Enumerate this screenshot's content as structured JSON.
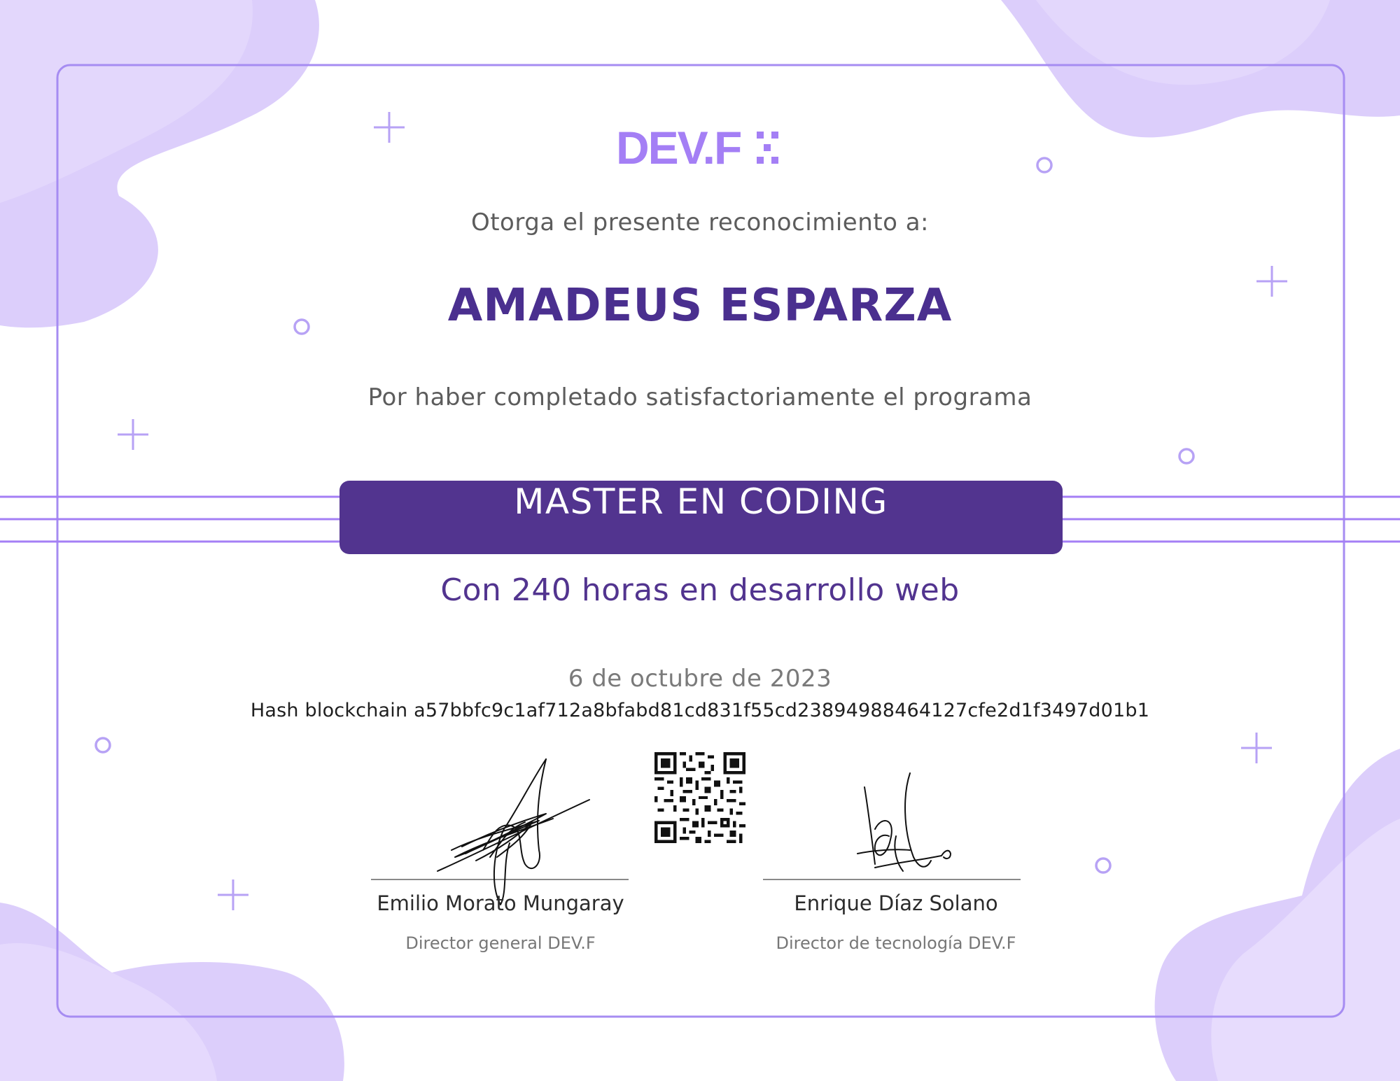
{
  "brand": {
    "logo_text": "DEV.F",
    "accent_color": "#a47ff5",
    "primary_color": "#52348f",
    "light_color": "#dccefb"
  },
  "certificate": {
    "intro": "Otorga el presente reconocimiento a:",
    "recipient": "AMADEUS ESPARZA",
    "reason": "Por haber completado satisfactoriamente el programa",
    "program": "MASTER EN CODING",
    "hours": "Con 240 horas en desarrollo web",
    "date": "6 de octubre de 2023",
    "hash": "Hash blockchain a57bbfc9c1af712a8bfabd81cd831f55cd23894988464127cfe2d1f3497d01b1"
  },
  "signatories": [
    {
      "name": "Emilio Morato Mungaray",
      "role": "Director general DEV.F"
    },
    {
      "name": "Enrique Díaz Solano",
      "role": "Director de tecnología DEV.F"
    }
  ]
}
